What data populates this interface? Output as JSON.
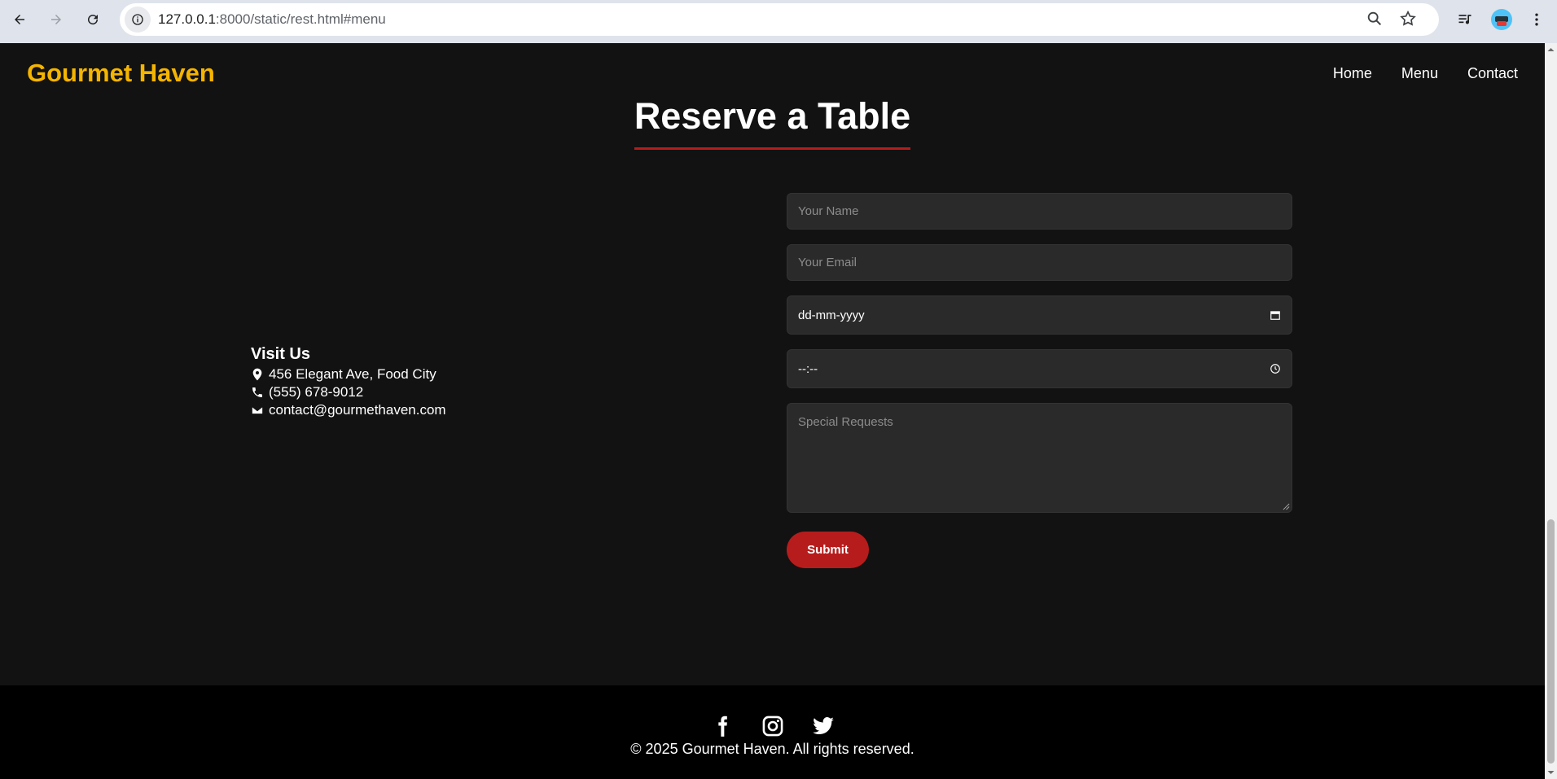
{
  "browser": {
    "url_host": "127.0.0.1",
    "url_path": ":8000/static/rest.html#menu"
  },
  "header": {
    "brand": "Gourmet Haven",
    "nav": [
      "Home",
      "Menu",
      "Contact"
    ]
  },
  "reservation": {
    "title": "Reserve a Table",
    "name_placeholder": "Your Name",
    "email_placeholder": "Your Email",
    "date_value": "dd-mm-yyyy",
    "time_value": "--:--",
    "requests_placeholder": "Special Requests",
    "submit_label": "Submit"
  },
  "visit": {
    "heading": "Visit Us",
    "address": "456 Elegant Ave, Food City",
    "phone": "(555) 678-9012",
    "email": "contact@gourmethaven.com"
  },
  "footer": {
    "social_icons": [
      "facebook-icon",
      "instagram-icon",
      "twitter-icon"
    ],
    "copyright": "© 2025 Gourmet Haven. All rights reserved."
  },
  "colors": {
    "accent": "#b71c1c",
    "brand": "#f4b400",
    "background": "#121212"
  }
}
